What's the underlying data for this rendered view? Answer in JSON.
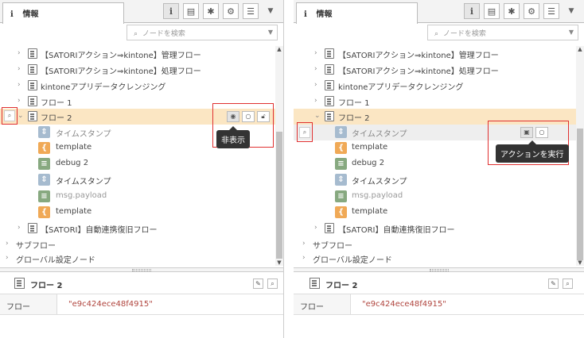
{
  "panels": [
    {
      "tab_title": "情報",
      "search_placeholder": "ノードを検索",
      "tree": [
        {
          "label": "【SATORIアクション⇒kintone】管理フロー",
          "indent": 0
        },
        {
          "label": "【SATORIアクション⇒kintone】処理フロー",
          "indent": 0
        },
        {
          "label": "kintoneアプリデータクレンジング",
          "indent": 0
        },
        {
          "label": "フロー 1",
          "indent": 0
        },
        {
          "label": "フロー 2",
          "indent": 0,
          "selected": true
        },
        {
          "label": "タイムスタンプ",
          "node": "inject",
          "dim": true
        },
        {
          "label": "template",
          "node": "template"
        },
        {
          "label": "debug 2",
          "node": "debug"
        },
        {
          "label": "タイムスタンプ",
          "node": "inject"
        },
        {
          "label": "msg.payload",
          "node": "debug",
          "placeholder": true
        },
        {
          "label": "template",
          "node": "template"
        },
        {
          "label": "【SATORI】自動連携復旧フロー",
          "indent": 0
        },
        {
          "label": "サブフロー",
          "group": true
        },
        {
          "label": "グローバル設定ノード",
          "group": true
        }
      ],
      "tooltip": "非表示",
      "info_title": "フロー 2",
      "prop_key": "フロー",
      "prop_value": "\"e9c424ece48f4915\""
    },
    {
      "tab_title": "情報",
      "search_placeholder": "ノードを検索",
      "tree": [
        {
          "label": "【SATORIアクション⇒kintone】管理フロー"
        },
        {
          "label": "【SATORIアクション⇒kintone】処理フロー"
        },
        {
          "label": "kintoneアプリデータクレンジング"
        },
        {
          "label": "フロー 1"
        },
        {
          "label": "フロー 2",
          "selected": true
        },
        {
          "label": "タイムスタンプ",
          "node": "inject",
          "dim": true,
          "hover": true
        },
        {
          "label": "template",
          "node": "template"
        },
        {
          "label": "debug 2",
          "node": "debug"
        },
        {
          "label": "タイムスタンプ",
          "node": "inject"
        },
        {
          "label": "msg.payload",
          "node": "debug",
          "placeholder": true
        },
        {
          "label": "template",
          "node": "template"
        },
        {
          "label": "【SATORI】自動連携復旧フロー"
        },
        {
          "label": "サブフロー",
          "group": true
        },
        {
          "label": "グローバル設定ノード",
          "group": true
        }
      ],
      "tooltip": "アクションを実行",
      "info_title": "フロー 2",
      "prop_key": "フロー",
      "prop_value": "\"e9c424ece48f4915\""
    }
  ],
  "icons": {
    "info": "i",
    "book": "book-icon",
    "bug": "bug-icon",
    "gear": "gear-icon",
    "db": "database-icon",
    "dropdown": "caret-down-icon",
    "search": "search-icon",
    "eye": "eye-icon",
    "circle": "circle-icon",
    "lock": "lock-icon",
    "run": "run-icon",
    "link": "link-icon"
  },
  "colors": {
    "selected_row": "#fbe6c3",
    "inject_node": "#a6bbcf",
    "template_node": "#f0a956",
    "debug_node": "#87a980",
    "highlight": "#e03030",
    "value_text": "#b0453e"
  }
}
